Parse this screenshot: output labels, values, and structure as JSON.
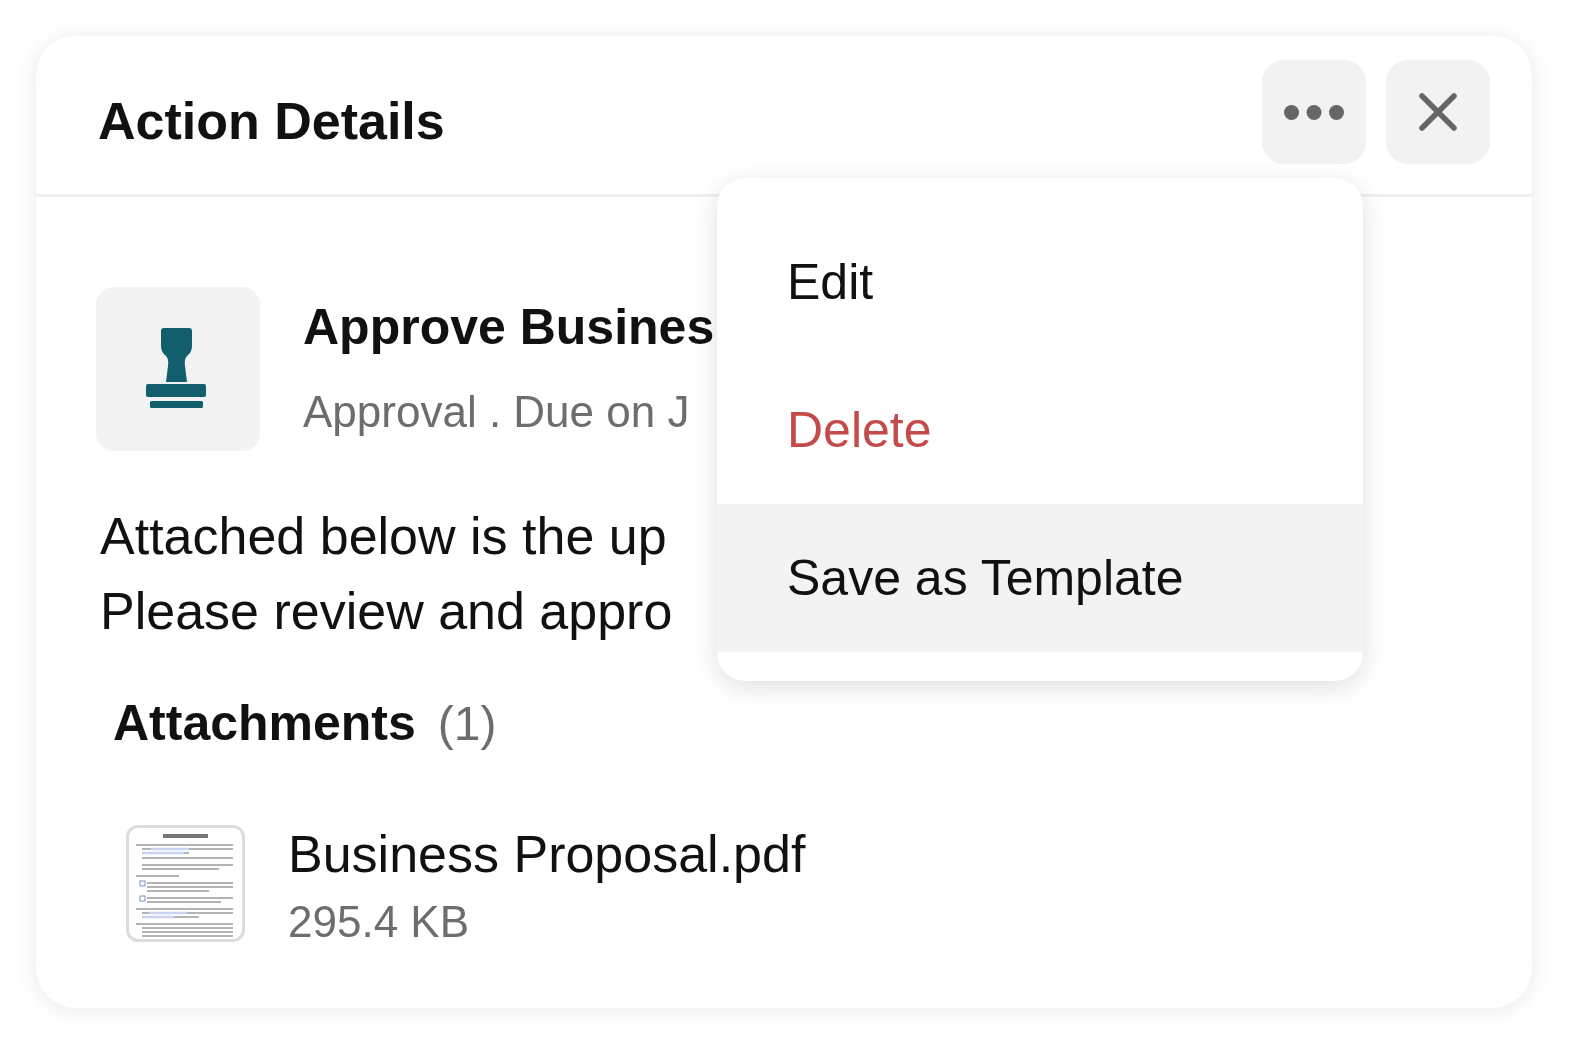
{
  "panel": {
    "title": "Action Details"
  },
  "action": {
    "title": "Approve Busines",
    "subtitle": "Approval . Due on J"
  },
  "description_lines": [
    "Attached below is the up",
    "Please review and appro"
  ],
  "attachments": {
    "heading": "Attachments",
    "count": "(1)",
    "files": [
      {
        "name": "Business Proposal.pdf",
        "size": "295.4 KB"
      }
    ]
  },
  "menu": {
    "items": [
      {
        "label": "Edit",
        "kind": "normal",
        "selected": false
      },
      {
        "label": "Delete",
        "kind": "danger",
        "selected": false
      },
      {
        "label": "Save as Template",
        "kind": "normal",
        "selected": true
      }
    ]
  }
}
